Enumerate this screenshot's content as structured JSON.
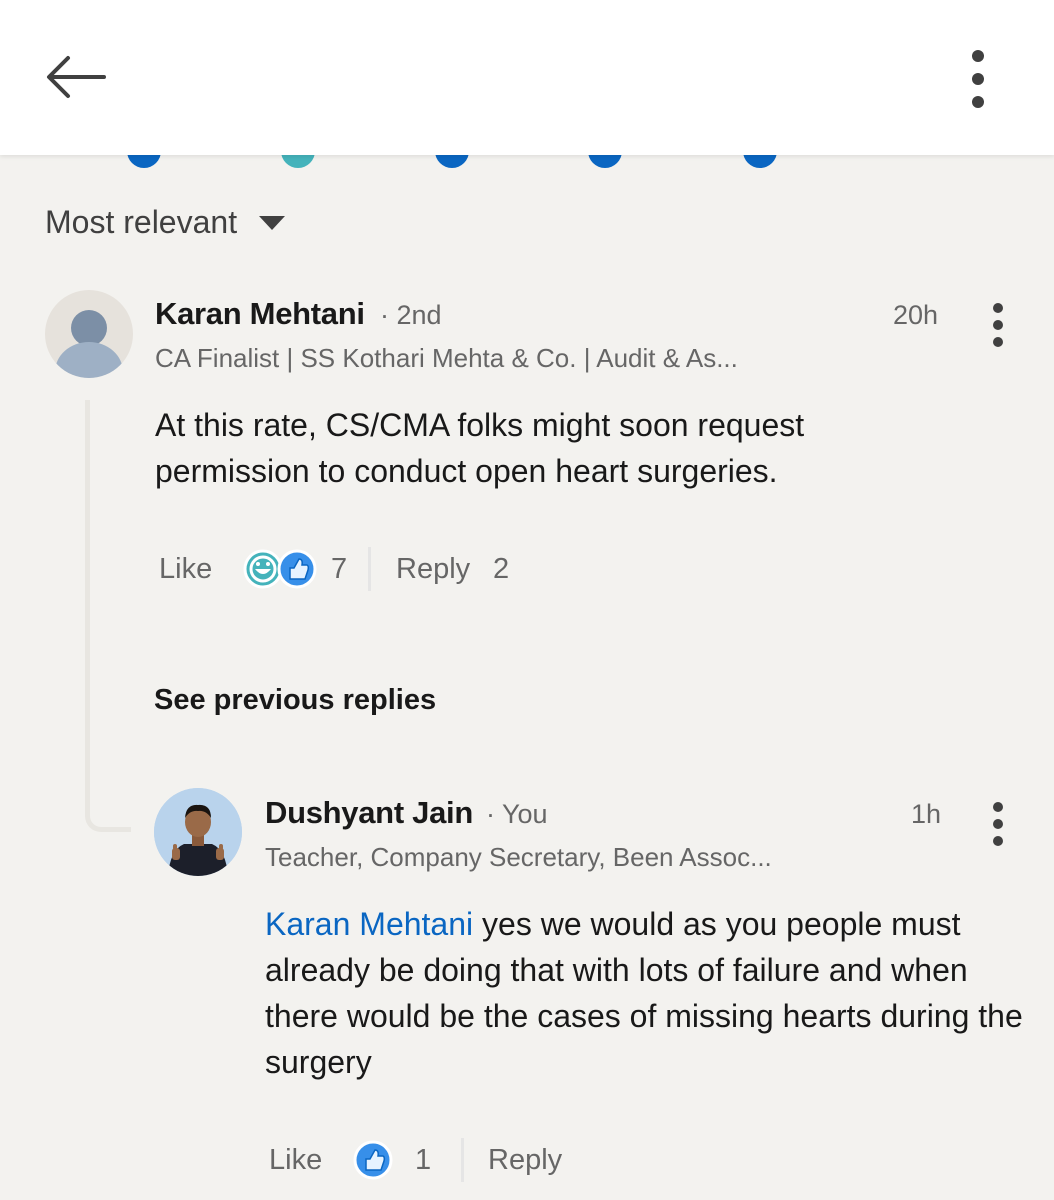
{
  "header": {
    "back_icon": "arrow-left-icon",
    "menu_icon": "more-vertical-icon"
  },
  "sort": {
    "label": "Most relevant",
    "icon": "caret-down-icon"
  },
  "comments": [
    {
      "author": "Karan Mehtani",
      "degree": "2nd",
      "headline": "CA Finalist | SS Kothari Mehta & Co. | Audit & As...",
      "time": "20h",
      "text": "At this rate, CS/CMA folks might soon request permission to conduct open heart surgeries.",
      "like_label": "Like",
      "reaction_icons": [
        "funny-reaction-icon",
        "like-reaction-icon"
      ],
      "reaction_count": "7",
      "reply_label": "Reply",
      "reply_count": "2"
    }
  ],
  "see_previous_replies": "See previous replies",
  "reply": {
    "author": "Dushyant Jain",
    "degree": "You",
    "headline": "Teacher, Company Secretary, Been Assoc...",
    "time": "1h",
    "mention": "Karan Mehtani",
    "text": " yes we would as you people must already be doing that with lots of failure and when there would be the cases of missing hearts during the surgery",
    "like_label": "Like",
    "reaction_icons": [
      "like-reaction-icon"
    ],
    "reaction_count": "1",
    "reply_label": "Reply"
  },
  "colors": {
    "brand_blue": "#0a66c2",
    "funny_teal": "#44b3bb",
    "text_primary": "#191919",
    "text_secondary": "#666666",
    "background": "#f3f2ef"
  }
}
